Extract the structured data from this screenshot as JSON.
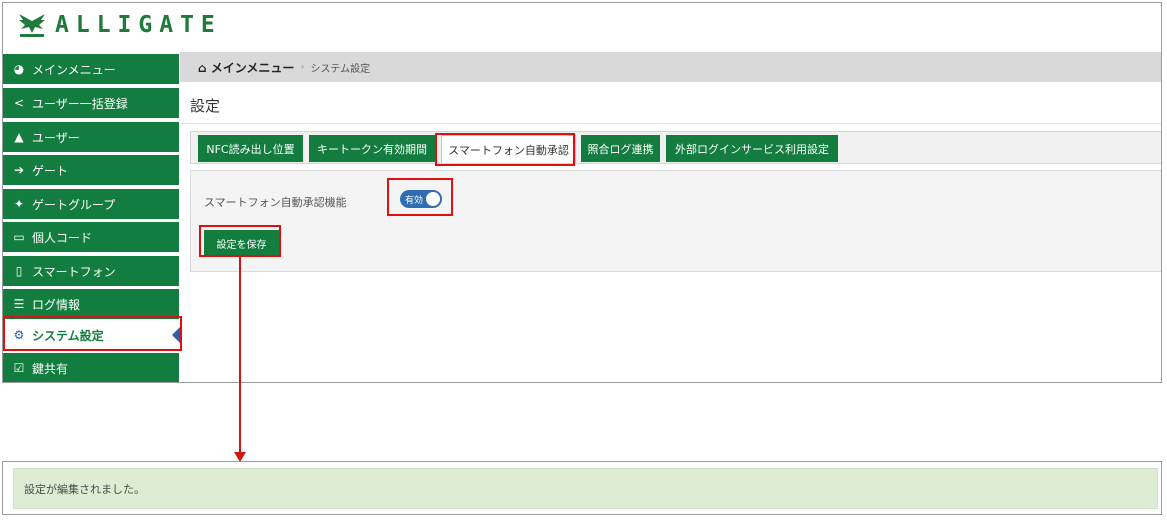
{
  "brand": {
    "name": "ALLIGATE",
    "color": "#1f7a3b"
  },
  "sidebar": {
    "items": [
      {
        "icon": "dashboard-icon",
        "glyph": "◕",
        "label": "メインメニュー"
      },
      {
        "icon": "share-icon",
        "glyph": "<",
        "label": "ユーザー一括登録"
      },
      {
        "icon": "user-icon",
        "glyph": "▲",
        "label": "ユーザー"
      },
      {
        "icon": "sign-in-icon",
        "glyph": "➔",
        "label": "ゲート"
      },
      {
        "icon": "users-icon",
        "glyph": "✦",
        "label": "ゲートグループ"
      },
      {
        "icon": "id-card-icon",
        "glyph": "▭",
        "label": "個人コード"
      },
      {
        "icon": "mobile-icon",
        "glyph": "▯",
        "label": "スマートフォン"
      },
      {
        "icon": "list-icon",
        "glyph": "☰",
        "label": "ログ情報"
      },
      {
        "icon": "gear-icon",
        "glyph": "⚙",
        "label": "システム設定",
        "active": true
      },
      {
        "icon": "check-square-icon",
        "glyph": "☑",
        "label": "鍵共有"
      }
    ]
  },
  "breadcrumb": {
    "home": "メインメニュー",
    "separator": "›",
    "current": "システム設定"
  },
  "page": {
    "title": "設定"
  },
  "tabs": [
    {
      "label": "NFC読み出し位置"
    },
    {
      "label": "キートークン有効期間"
    },
    {
      "label": "スマートフォン自動承認",
      "active": true
    },
    {
      "label": "照合ログ連携"
    },
    {
      "label": "外部ログインサービス利用設定"
    }
  ],
  "setting": {
    "label": "スマートフォン自動承認機能",
    "toggle_text": "有効",
    "enabled": true
  },
  "save_button": {
    "label": "設定を保存"
  },
  "flash": {
    "message": "設定が編集されました。"
  },
  "colors": {
    "primary_green": "#137d3f",
    "highlight_red": "#e01010",
    "toggle_blue": "#2f6db3",
    "flash_bg": "#dcedd4"
  }
}
